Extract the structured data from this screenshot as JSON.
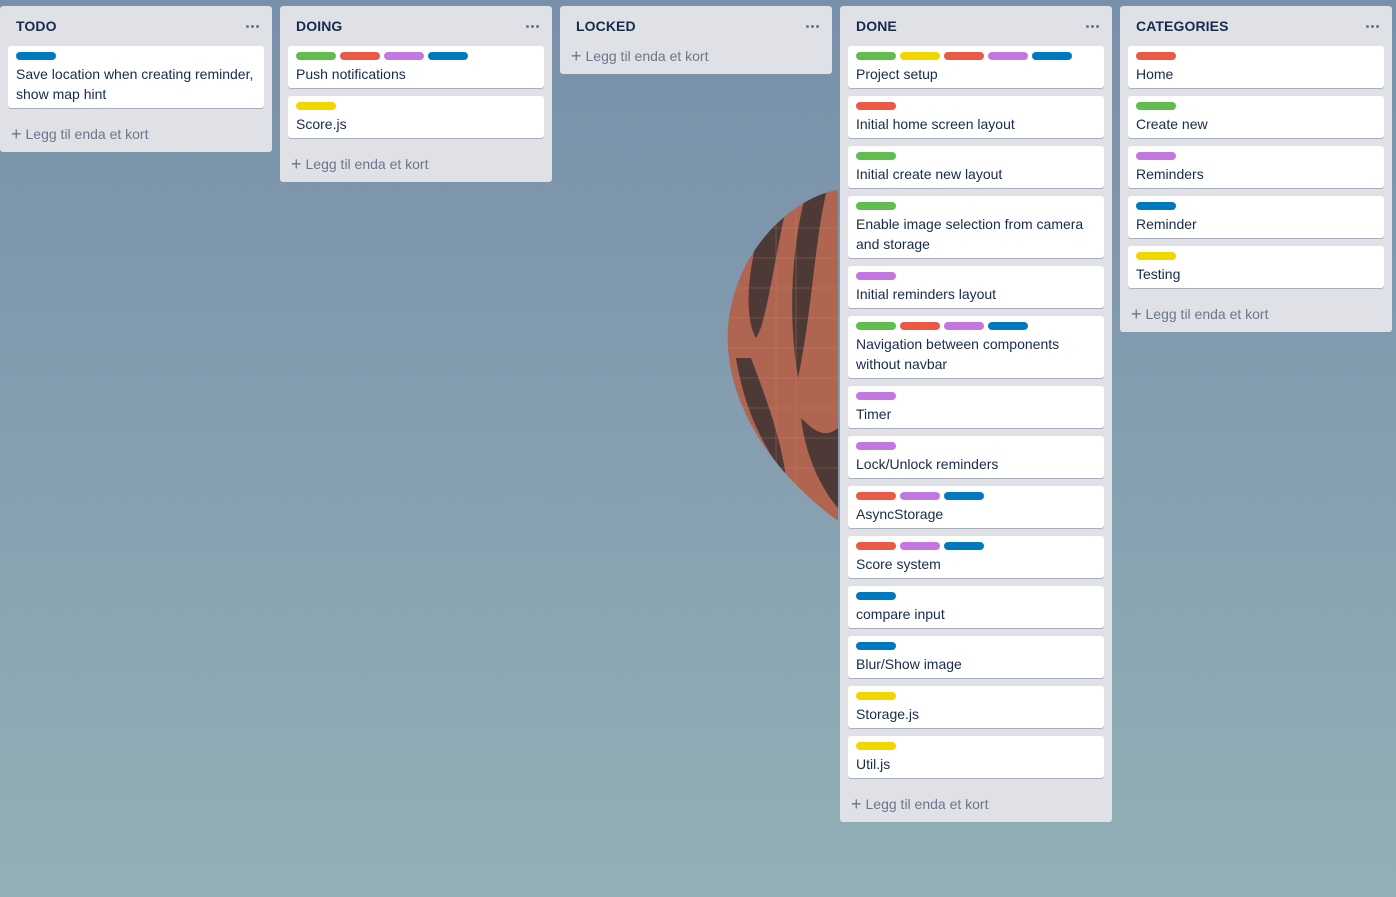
{
  "colors": {
    "green": "#61bd4f",
    "yellow": "#f2d600",
    "red": "#eb5a46",
    "purple": "#c377e0",
    "blue": "#0079bf"
  },
  "add_card_label": "Legg til enda et kort",
  "add_icon": "plus-icon",
  "menu_icon": "ellipsis-icon",
  "lists": [
    {
      "title": "TODO",
      "cards": [
        {
          "labels": [
            "blue"
          ],
          "title": "Save location when creating reminder, show map hint"
        }
      ]
    },
    {
      "title": "DOING",
      "cards": [
        {
          "labels": [
            "green",
            "red",
            "purple",
            "blue"
          ],
          "title": "Push notifications"
        },
        {
          "labels": [
            "yellow"
          ],
          "title": "Score.js"
        }
      ]
    },
    {
      "title": "LOCKED",
      "cards": []
    },
    {
      "title": "DONE",
      "cards": [
        {
          "labels": [
            "green",
            "yellow",
            "red",
            "purple",
            "blue"
          ],
          "title": "Project setup"
        },
        {
          "labels": [
            "red"
          ],
          "title": "Initial home screen layout"
        },
        {
          "labels": [
            "green"
          ],
          "title": "Initial create new layout"
        },
        {
          "labels": [
            "green"
          ],
          "title": "Enable image selection from camera and storage"
        },
        {
          "labels": [
            "purple"
          ],
          "title": "Initial reminders layout"
        },
        {
          "labels": [
            "green",
            "red",
            "purple",
            "blue"
          ],
          "title": "Navigation between components without navbar"
        },
        {
          "labels": [
            "purple"
          ],
          "title": "Timer"
        },
        {
          "labels": [
            "purple"
          ],
          "title": "Lock/Unlock reminders"
        },
        {
          "labels": [
            "red",
            "purple",
            "blue"
          ],
          "title": "AsyncStorage"
        },
        {
          "labels": [
            "red",
            "purple",
            "blue"
          ],
          "title": "Score system"
        },
        {
          "labels": [
            "blue"
          ],
          "title": "compare input"
        },
        {
          "labels": [
            "blue"
          ],
          "title": "Blur/Show image"
        },
        {
          "labels": [
            "yellow"
          ],
          "title": "Storage.js"
        },
        {
          "labels": [
            "yellow"
          ],
          "title": "Util.js"
        }
      ]
    },
    {
      "title": "CATEGORIES",
      "cards": [
        {
          "labels": [
            "red"
          ],
          "title": "Home"
        },
        {
          "labels": [
            "green"
          ],
          "title": "Create new"
        },
        {
          "labels": [
            "purple"
          ],
          "title": "Reminders"
        },
        {
          "labels": [
            "blue"
          ],
          "title": "Reminder"
        },
        {
          "labels": [
            "yellow"
          ],
          "title": "Testing"
        }
      ]
    }
  ]
}
